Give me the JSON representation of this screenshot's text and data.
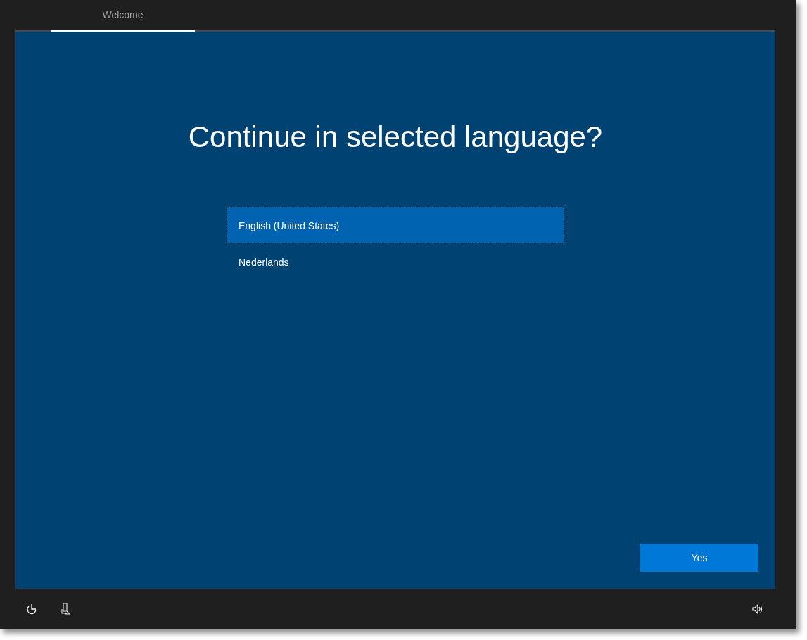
{
  "tabs": [
    {
      "label": "Welcome",
      "selected": true
    }
  ],
  "heading": "Continue in selected language?",
  "languages": [
    {
      "label": "English (United States)",
      "selected": true
    },
    {
      "label": "Nederlands",
      "selected": false
    }
  ],
  "buttons": [
    {
      "label": "Yes"
    }
  ]
}
